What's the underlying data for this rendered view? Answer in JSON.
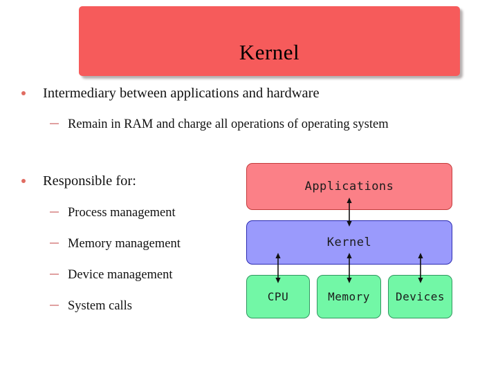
{
  "slide": {
    "title": "Kernel",
    "title_bar_color": "#f65b5b",
    "background_color": "#ffffff"
  },
  "content": {
    "bullets": [
      {
        "level": 1,
        "text": "Intermediary between applications and hardware"
      },
      {
        "level": 2,
        "text": "Remain in RAM and charge all operations of operating system"
      },
      {
        "level": 1,
        "text": "Responsible for:"
      },
      {
        "level": 2,
        "text": "Process management"
      },
      {
        "level": 2,
        "text": "Memory management"
      },
      {
        "level": 2,
        "text": "Device management"
      },
      {
        "level": 2,
        "text": "System calls"
      }
    ],
    "bullet_marker_color": "#e06c62",
    "dash_marker_color": "#e0a0a0"
  },
  "diagram": {
    "layers": [
      {
        "id": "applications",
        "label": "Applications",
        "fill": "#fb8087",
        "stroke": "#c33b3b"
      },
      {
        "id": "kernel",
        "label": "Kernel",
        "fill": "#9a9afc",
        "stroke": "#2a2ab0"
      }
    ],
    "hardware": [
      {
        "id": "cpu",
        "label": "CPU",
        "fill": "#72f7a6",
        "stroke": "#31955f"
      },
      {
        "id": "memory",
        "label": "Memory",
        "fill": "#72f7a6",
        "stroke": "#31955f"
      },
      {
        "id": "devices",
        "label": "Devices",
        "fill": "#72f7a6",
        "stroke": "#31955f"
      }
    ],
    "connectors": [
      {
        "id": "applications-kernel",
        "type": "double-headed-arrow"
      },
      {
        "id": "kernel-cpu",
        "type": "double-headed-arrow"
      },
      {
        "id": "kernel-memory",
        "type": "double-headed-arrow"
      },
      {
        "id": "kernel-devices",
        "type": "double-headed-arrow"
      }
    ],
    "arrow_color": "#111111"
  }
}
